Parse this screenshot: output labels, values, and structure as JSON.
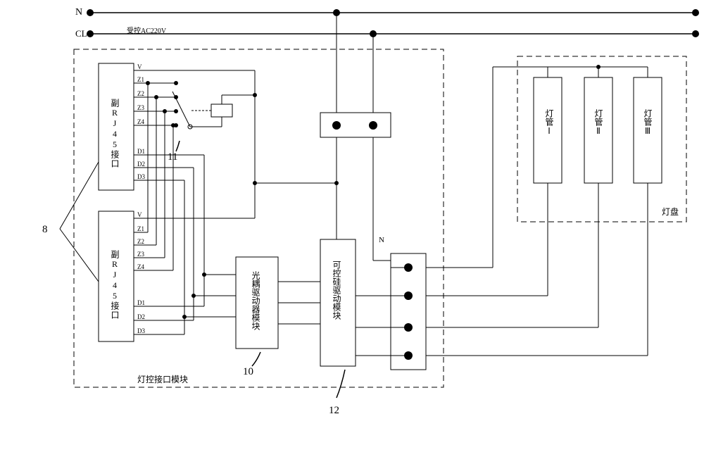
{
  "rails": {
    "n": "N",
    "cl": "CL",
    "controlled_ac": "受控AC220V",
    "n2": "N"
  },
  "rj45": {
    "primary": "副RJ45接口",
    "secondary": "副RJ45接口"
  },
  "pins": {
    "v": "V",
    "z1": "Z1",
    "z2": "Z2",
    "z3": "Z3",
    "z4": "Z4",
    "d1": "D1",
    "d2": "D2",
    "d3": "D3"
  },
  "modules": {
    "opto_driver": "光耦驱动器模块",
    "thyristor_driver": "可控硅驱动模块",
    "lamp_interface": "灯控接口模块"
  },
  "lamp_panel": {
    "title": "灯盘",
    "tube1": "灯管Ⅰ",
    "tube2": "灯管Ⅱ",
    "tube3": "灯管Ⅲ"
  },
  "callouts": {
    "c8": "8",
    "c10": "10",
    "c11": "11",
    "c12": "12"
  }
}
